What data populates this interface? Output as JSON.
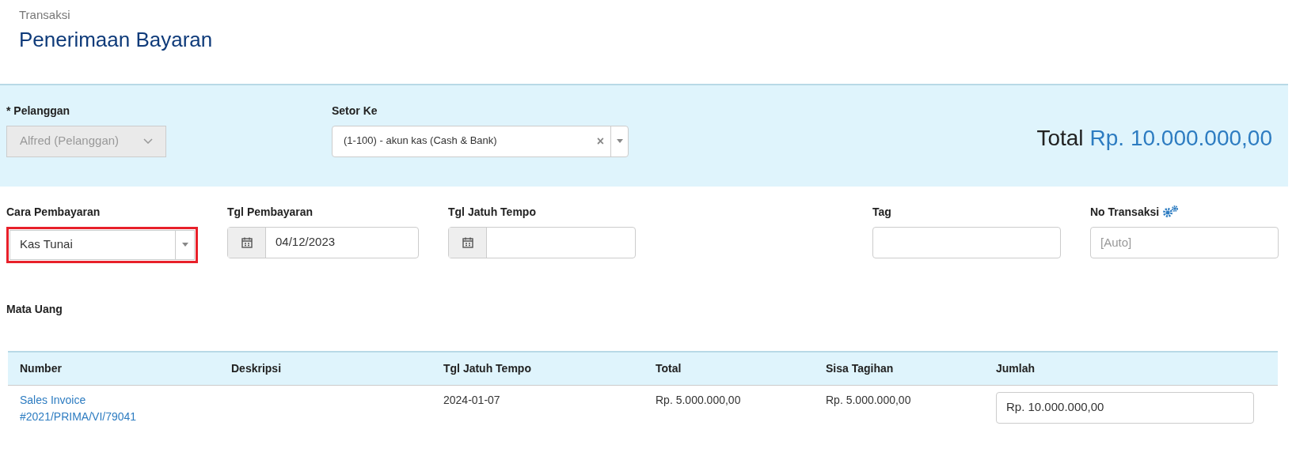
{
  "header": {
    "breadcrumb": "Transaksi",
    "title": "Penerimaan Bayaran"
  },
  "top": {
    "customer": {
      "label": "* Pelanggan",
      "value": "Alfred (Pelanggan)",
      "disabled": true
    },
    "deposit": {
      "label": "Setor Ke",
      "value": "(1-100) - akun kas (Cash & Bank)",
      "clear": "×"
    },
    "total": {
      "label": "Total",
      "value": "Rp. 10.000.000,00"
    }
  },
  "fields": [
    {
      "kind": "select",
      "label": "Cara Pembayaran",
      "value": "Kas Tunai",
      "highlighted": true
    },
    {
      "kind": "date",
      "label": "Tgl Pembayaran",
      "value": "04/12/2023",
      "highlighted": false
    },
    {
      "kind": "date",
      "label": "Tgl Jatuh Tempo",
      "highlighted": false
    },
    {
      "kind": "spacer"
    },
    {
      "kind": "text",
      "label": "Tag",
      "highlighted": false
    },
    {
      "kind": "text",
      "label": "No Transaksi",
      "placeholder": "[Auto]",
      "settings": true,
      "highlighted": false
    }
  ],
  "currency": {
    "label": "Mata Uang"
  },
  "table": {
    "columns": [
      "Number",
      "Deskripsi",
      "Tgl Jatuh Tempo",
      "Total",
      "Sisa Tagihan",
      "Jumlah"
    ],
    "rows": [
      {
        "number": [
          "Sales Invoice",
          "#2021/PRIMA/VI/79041"
        ],
        "description": "",
        "due": "2024-01-07",
        "total": "Rp. 5.000.000,00",
        "remaining": "Rp. 5.000.000,00",
        "amount": "Rp. 10.000.000,00"
      }
    ]
  }
}
